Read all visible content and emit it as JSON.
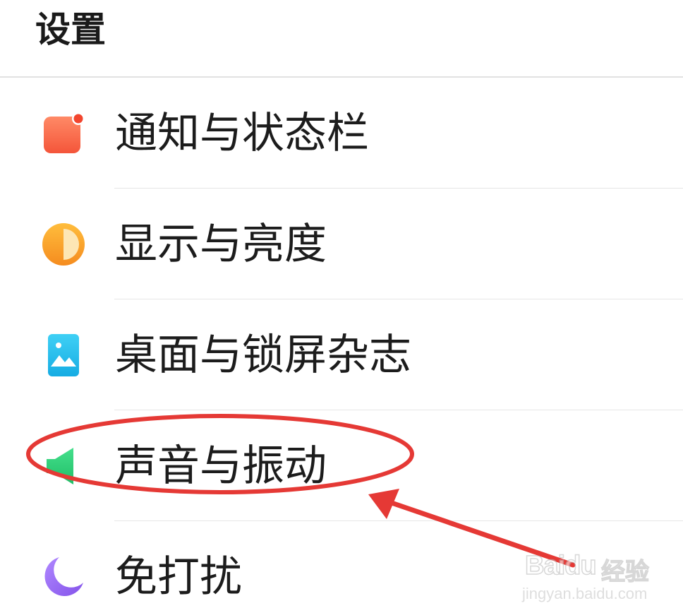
{
  "header": {
    "title": "设置"
  },
  "settings": {
    "items": [
      {
        "label": "通知与状态栏",
        "icon": "notification-icon",
        "color": "#f86a4a"
      },
      {
        "label": "显示与亮度",
        "icon": "brightness-icon",
        "color": "#f6a12a"
      },
      {
        "label": "桌面与锁屏杂志",
        "icon": "wallpaper-icon",
        "color": "#27c1ee"
      },
      {
        "label": "声音与振动",
        "icon": "sound-icon",
        "color": "#2fcf78"
      },
      {
        "label": "免打扰",
        "icon": "moon-icon",
        "color": "#9a6ff0"
      }
    ]
  },
  "annotation": {
    "highlighted_item": "声音与振动",
    "color": "#e53935"
  },
  "watermark": {
    "logo": "Baidu",
    "brand": "经验",
    "url": "jingyan.baidu.com"
  }
}
